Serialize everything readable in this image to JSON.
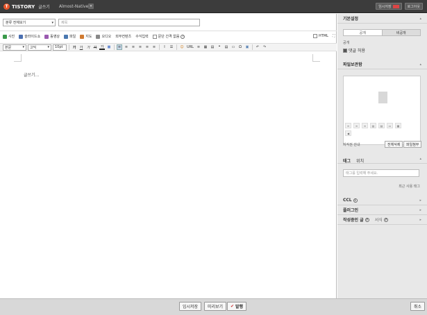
{
  "topbar": {
    "logo_mark": "T",
    "brand": "TISTORY",
    "page_label": "글쓰기",
    "blog_name": "Almost-Native",
    "blog_dropdown": "▾",
    "temp_save": "임시저장",
    "logout": "로그아웃"
  },
  "editor": {
    "category_select": "분류 전체보기",
    "category_arrow": "▾",
    "title_placeholder": "제목",
    "insert_items": [
      {
        "label": "사진",
        "color": "#3a9a4a"
      },
      {
        "label": "슬라이드쇼",
        "color": "#4a6fb0"
      },
      {
        "label": "동영상",
        "color": "#9a5ab0"
      },
      {
        "label": "파일",
        "color": "#4a78b0"
      },
      {
        "label": "지도",
        "color": "#d07a30"
      },
      {
        "label": "오디오",
        "color": "#888888"
      },
      {
        "label": "외부컨텐츠",
        "color": ""
      },
      {
        "label": "수식입력",
        "color": ""
      }
    ],
    "no_spacing": "문단 간격 없음",
    "html_label": "HTML",
    "expand_icon": "⛶",
    "format": {
      "paragraph": "본문",
      "font": "고딕",
      "size": "10pt",
      "buttons": [
        "가",
        "가",
        "가",
        "가",
        "가",
        "■",
        "≡",
        "≡",
        "≡",
        "≡",
        "≡",
        "≡",
        "I",
        "☰",
        "☺",
        "URL",
        "≡",
        "▦",
        "▤",
        "❝",
        "▤",
        "▭",
        "Ω",
        "▣",
        "↶",
        "↷"
      ]
    },
    "content_placeholder": "글쓰기..."
  },
  "sidebar": {
    "basic_settings": "기본설정",
    "visibility_label": "공개",
    "public": "공개",
    "private": "비공개",
    "allow_comments": "댓글 허용",
    "file_box": "파일보관함",
    "file_info": "저작권 안내",
    "delete_all": "전체삭제",
    "attach_file": "파일첨부",
    "tag": "태그",
    "location": "위치",
    "tag_placeholder": "태그를 입력해 주세요.",
    "recent_tags": "최근 사용 태그",
    "ccl": "CCL",
    "plugin": "플러그인",
    "drafts": "작성중인 글",
    "format": "서식",
    "arrow_down": "▸",
    "arrow_up": "▴"
  },
  "footer": {
    "temp_save": "임시저장",
    "preview": "미리보기",
    "publish": "발행",
    "cancel": "취소"
  }
}
